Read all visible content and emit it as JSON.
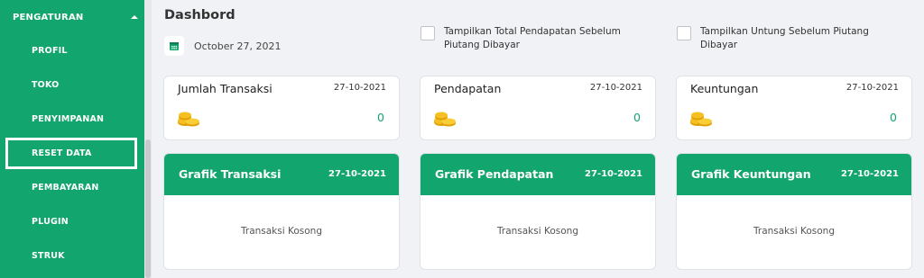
{
  "colors": {
    "accent": "#12a66e",
    "background": "#f0f2f5"
  },
  "sidebar": {
    "section_label": "PENGATURAN",
    "section_icon": "chevron-up-icon",
    "items": [
      {
        "label": "PROFIL"
      },
      {
        "label": "TOKO"
      },
      {
        "label": "PENYIMPANAN"
      },
      {
        "label": "RESET DATA",
        "active": true
      },
      {
        "label": "PEMBAYARAN"
      },
      {
        "label": "PLUGIN"
      },
      {
        "label": "STRUK"
      }
    ]
  },
  "main": {
    "title": "Dashbord",
    "date": "October 27, 2021",
    "date_icon": "calendar-icon",
    "checkboxes": [
      {
        "label": "Tampilkan Total Pendapatan Sebelum Piutang Dibayar",
        "checked": false
      },
      {
        "label": "Tampilkan Untung Sebelum Piutang Dibayar",
        "checked": false
      }
    ],
    "stat_cards": [
      {
        "title": "Jumlah Transaksi",
        "date": "27-10-2021",
        "value": "0",
        "icon": "coins-icon"
      },
      {
        "title": "Pendapatan",
        "date": "27-10-2021",
        "value": "0",
        "icon": "coins-icon"
      },
      {
        "title": "Keuntungan",
        "date": "27-10-2021",
        "value": "0",
        "icon": "coins-icon"
      }
    ],
    "chart_cards": [
      {
        "title": "Grafik Transaksi",
        "date": "27-10-2021",
        "empty_text": "Transaksi Kosong"
      },
      {
        "title": "Grafik Pendapatan",
        "date": "27-10-2021",
        "empty_text": "Transaksi Kosong"
      },
      {
        "title": "Grafik Keuntungan",
        "date": "27-10-2021",
        "empty_text": "Transaksi Kosong"
      }
    ]
  }
}
